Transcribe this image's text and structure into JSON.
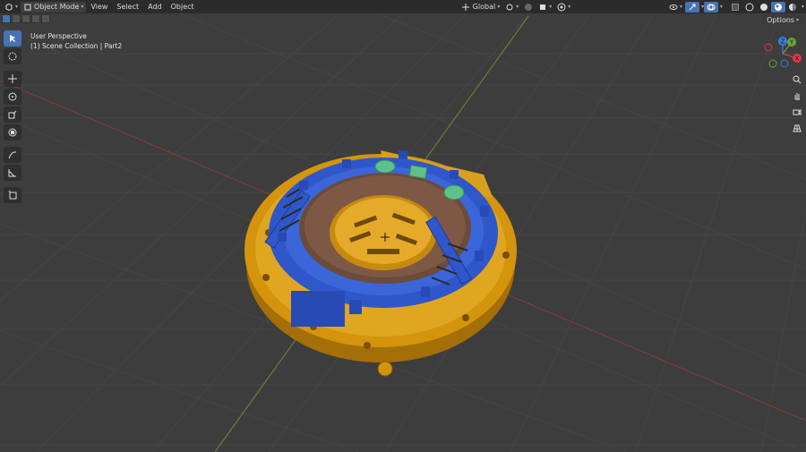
{
  "header": {
    "editor_type_icon": "view3d-icon",
    "mode": "Object Mode",
    "menus": [
      "View",
      "Select",
      "Add",
      "Object"
    ],
    "orientation": "Global",
    "options_label": "Options"
  },
  "viewport": {
    "perspective": "User Perspective",
    "collection": "(1) Scene Collection | Part2"
  },
  "toolbar": {
    "tools": [
      "select-box-icon",
      "cursor-icon",
      "move-icon",
      "rotate-icon",
      "scale-icon",
      "transform-icon",
      "annotate-icon",
      "measure-icon",
      "add-cube-icon"
    ]
  },
  "gizmo": {
    "axes": [
      "X",
      "Y",
      "Z"
    ],
    "colors": {
      "x": "#e23a4a",
      "y": "#6ba532",
      "z": "#3a7ee2"
    }
  },
  "colors": {
    "accent": "#4772b3",
    "part_gold": "#d4950c",
    "part_blue": "#2f57c9",
    "part_brown": "#6b4b3a",
    "part_green": "#5fc08a"
  }
}
